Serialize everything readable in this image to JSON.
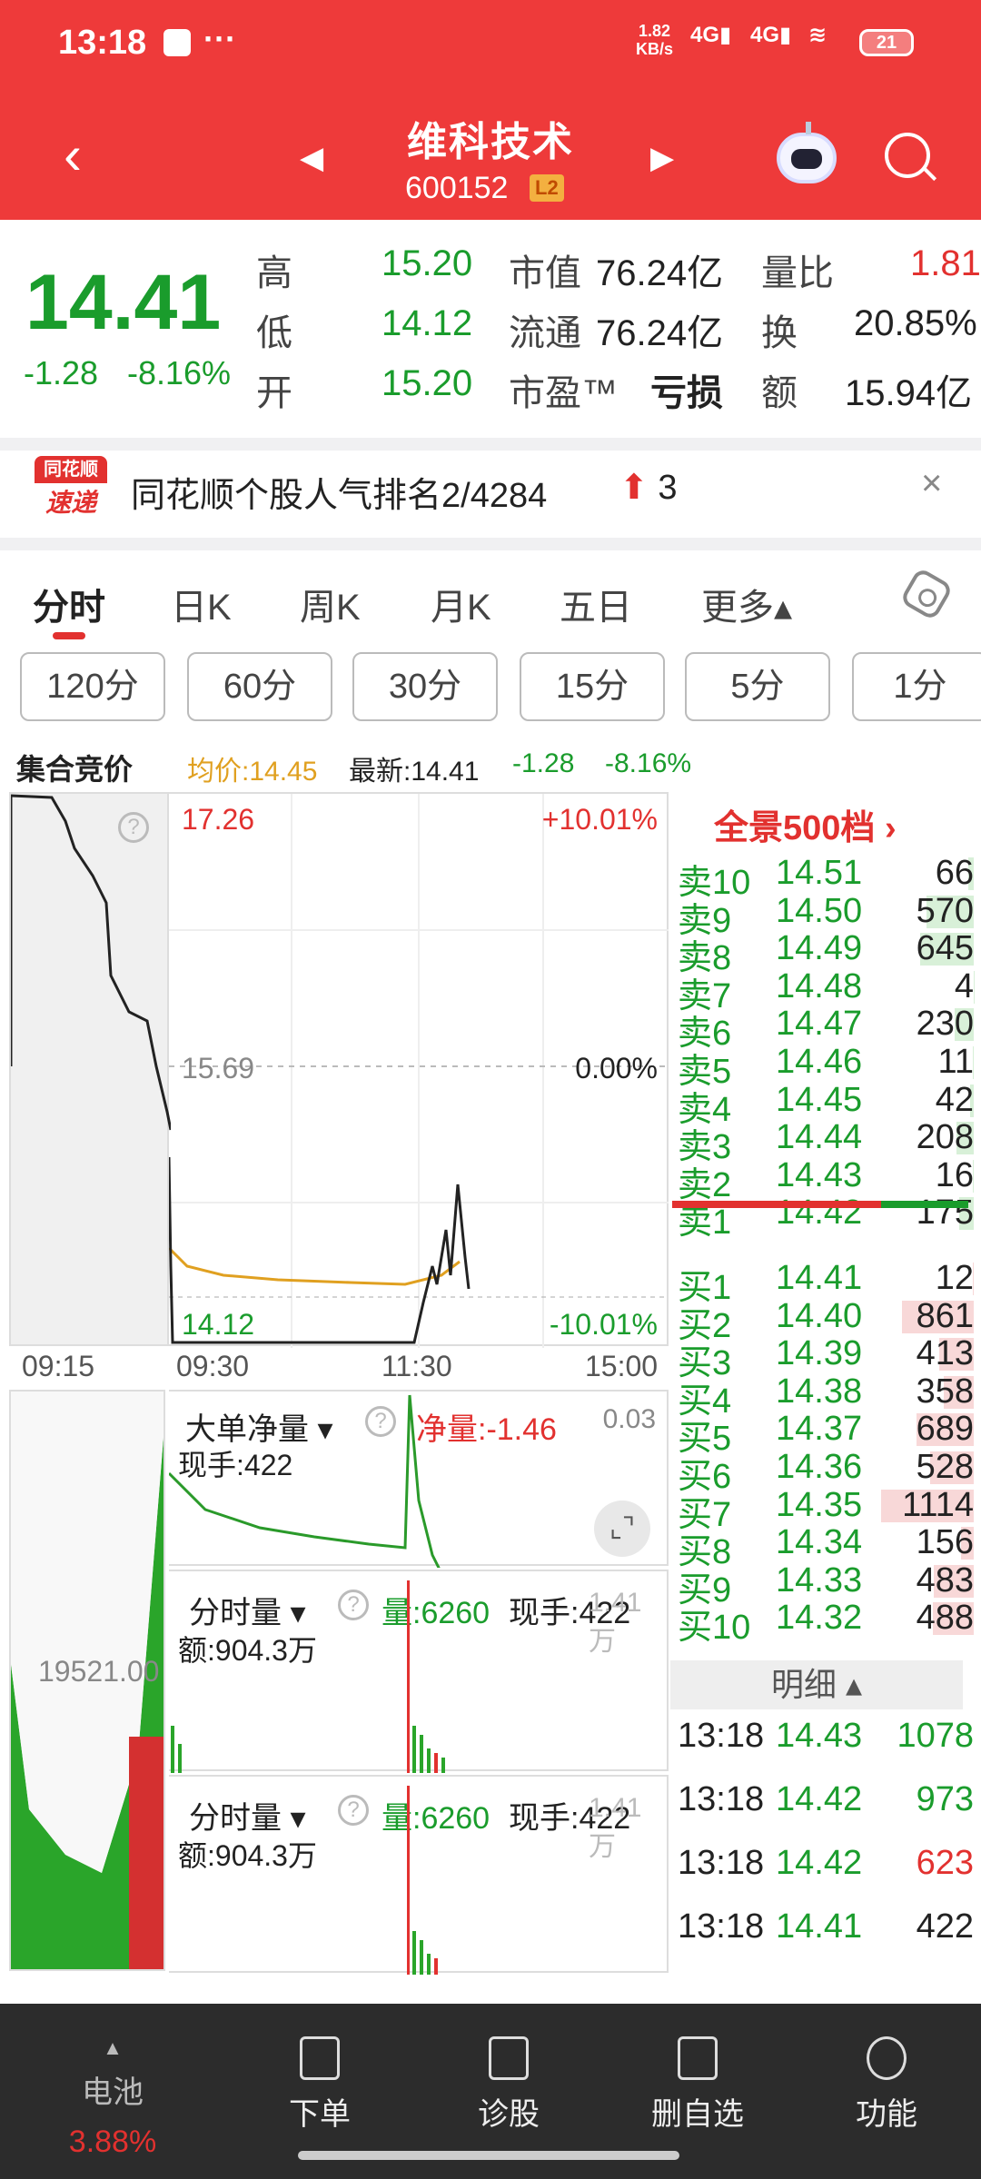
{
  "status": {
    "time": "13:18",
    "dots": "···",
    "speed": "1.82",
    "speed_unit": "KB/s",
    "net1": "4G",
    "net2": "4G",
    "battery": "21"
  },
  "header": {
    "name": "维科技术",
    "code": "600152",
    "level": "L2"
  },
  "quote": {
    "price": "14.41",
    "change": "-1.28",
    "change_pct": "-8.16%",
    "high_label": "高",
    "high": "15.20",
    "low_label": "低",
    "low": "14.12",
    "open_label": "开",
    "open": "15.20",
    "mcap_label": "市值",
    "mcap": "76.24亿",
    "float_label": "流通",
    "float": "76.24亿",
    "pe_label": "市盈™",
    "pe": "亏损",
    "vr_label": "量比",
    "vr": "1.81",
    "turn_label": "换",
    "turn": "20.85%",
    "amt_label": "额",
    "amt": "15.94亿"
  },
  "news": {
    "logo_top": "同花顺",
    "logo_bottom": "速递",
    "text": "同花顺个股人气排名2/4284",
    "rank_change": "3"
  },
  "tabs": [
    "分时",
    "日K",
    "周K",
    "月K",
    "五日",
    "更多▴"
  ],
  "periods": [
    "120分",
    "60分",
    "30分",
    "15分",
    "5分",
    "1分"
  ],
  "chart": {
    "auction_label": "集合竞价",
    "avg": "均价:14.45",
    "latest": "最新:14.41",
    "chg": "-1.28",
    "chg_pct": "-8.16%",
    "top_price": "17.26",
    "top_pct": "+10.01%",
    "mid_price": "15.69",
    "mid_pct": "0.00%",
    "bot_price": "14.12",
    "bot_pct": "-10.01%",
    "x_labels": [
      "09:15",
      "09:30",
      "11:30",
      "15:00"
    ],
    "auction_value": "19521.00"
  },
  "orderbook": {
    "title": "全景500档 ›",
    "asks": [
      {
        "l": "卖10",
        "p": "14.51",
        "q": "66"
      },
      {
        "l": "卖9",
        "p": "14.50",
        "q": "570"
      },
      {
        "l": "卖8",
        "p": "14.49",
        "q": "645"
      },
      {
        "l": "卖7",
        "p": "14.48",
        "q": "4"
      },
      {
        "l": "卖6",
        "p": "14.47",
        "q": "230"
      },
      {
        "l": "卖5",
        "p": "14.46",
        "q": "11"
      },
      {
        "l": "卖4",
        "p": "14.45",
        "q": "42"
      },
      {
        "l": "卖3",
        "p": "14.44",
        "q": "208"
      },
      {
        "l": "卖2",
        "p": "14.43",
        "q": "16"
      },
      {
        "l": "卖1",
        "p": "14.42",
        "q": "175"
      }
    ],
    "bids": [
      {
        "l": "买1",
        "p": "14.41",
        "q": "12"
      },
      {
        "l": "买2",
        "p": "14.40",
        "q": "861"
      },
      {
        "l": "买3",
        "p": "14.39",
        "q": "413"
      },
      {
        "l": "买4",
        "p": "14.38",
        "q": "358"
      },
      {
        "l": "买5",
        "p": "14.37",
        "q": "689"
      },
      {
        "l": "买6",
        "p": "14.36",
        "q": "528"
      },
      {
        "l": "买7",
        "p": "14.35",
        "q": "1114"
      },
      {
        "l": "买8",
        "p": "14.34",
        "q": "156"
      },
      {
        "l": "买9",
        "p": "14.33",
        "q": "483"
      },
      {
        "l": "买10",
        "p": "14.32",
        "q": "488"
      }
    ],
    "detail_label": "明细 ▴",
    "details": [
      {
        "t": "13:18",
        "p": "14.43",
        "q": "1078",
        "c": "green"
      },
      {
        "t": "13:18",
        "p": "14.42",
        "q": "973",
        "c": "green"
      },
      {
        "t": "13:18",
        "p": "14.42",
        "q": "623",
        "c": "red"
      },
      {
        "t": "13:18",
        "p": "14.41",
        "q": "422",
        "c": "dark"
      }
    ]
  },
  "panels": {
    "p1_sel": "大单净量 ▾",
    "p1_val": "净量:-1.46",
    "p1_right": "0.03",
    "p1_hand": "现手:422",
    "p2_sel": "分时量 ▾",
    "p2_vol": "量:6260",
    "p2_hand": "现手:422",
    "p2_amt": "额:904.3万",
    "p2_ghost": "1.41万",
    "p3_sel": "分时量 ▾",
    "p3_vol": "量:6260",
    "p3_hand": "现手:422",
    "p3_amt": "额:904.3万",
    "p3_ghost": "1.41万"
  },
  "nav": [
    {
      "label": "电池",
      "sub": "3.88%"
    },
    {
      "label": "下单"
    },
    {
      "label": "诊股"
    },
    {
      "label": "删自选"
    },
    {
      "label": "功能"
    }
  ]
}
